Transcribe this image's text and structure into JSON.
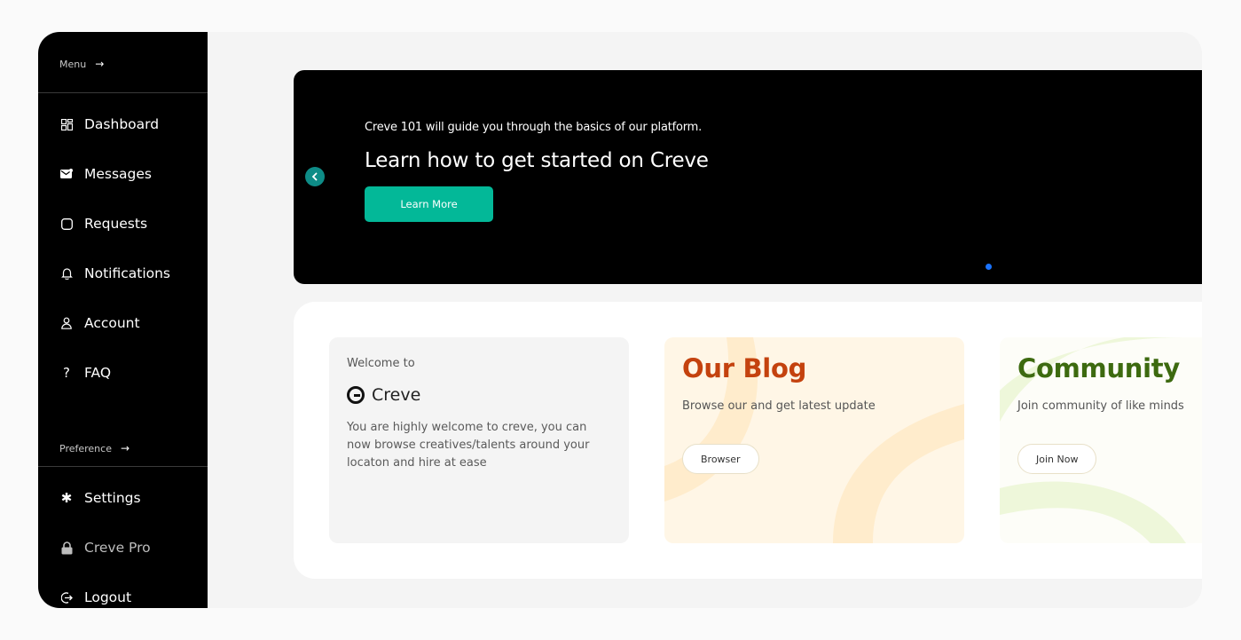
{
  "sidebar": {
    "menu_label": "Menu",
    "preference_label": "Preference",
    "items": [
      {
        "label": "Dashboard",
        "icon": "dashboard-icon"
      },
      {
        "label": "Messages",
        "icon": "mail-icon"
      },
      {
        "label": "Requests",
        "icon": "square-icon"
      },
      {
        "label": "Notifications",
        "icon": "bell-icon"
      },
      {
        "label": "Account",
        "icon": "user-icon"
      },
      {
        "label": "FAQ",
        "icon": "question-icon"
      }
    ],
    "pref_items": [
      {
        "label": "Settings",
        "icon": "gear-icon"
      },
      {
        "label": "Creve Pro",
        "icon": "lock-icon"
      },
      {
        "label": "Logout",
        "icon": "logout-icon"
      }
    ]
  },
  "hero": {
    "subtitle": "Creve 101 will guide you through the basics of our platform.",
    "title": "Learn how to get started on Creve",
    "button_label": "Learn More",
    "dot_color": "#1a73ff",
    "button_color": "#03b898"
  },
  "welcome": {
    "small": "Welcome to",
    "brand": "Creve",
    "description": "You are highly welcome to creve, you can now browse creatives/talents around your locaton and hire at ease"
  },
  "blog": {
    "title": "Our Blog",
    "subtitle": "Browse our and get latest update",
    "button_label": "Browser",
    "title_color": "#c4420e"
  },
  "community": {
    "title": "Community",
    "subtitle": "Join community of like minds",
    "button_label": "Join Now",
    "title_color": "#3d6a10"
  }
}
